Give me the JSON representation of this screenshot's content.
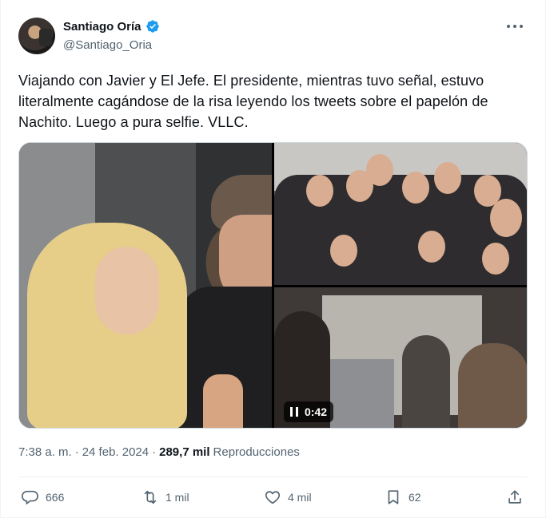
{
  "author": {
    "display_name": "Santiago Oría",
    "handle": "@Santiago_Oria",
    "verified": true
  },
  "tweet": {
    "text": "Viajando con Javier y El Jefe. El presidente, mientras tuvo señal, estuvo literalmente cagándose de la risa leyendo los tweets sobre el papelón de Nachito. Luego a pura selfie. VLLC."
  },
  "media": {
    "video_duration": "0:42"
  },
  "meta": {
    "time": "7:38 a. m.",
    "separator": "·",
    "date": "24 feb. 2024",
    "separator2": "·",
    "views_count": "289,7 mil",
    "views_label": "Reproducciones"
  },
  "actions": {
    "replies": "666",
    "reposts": "1 mil",
    "likes": "4 mil",
    "bookmarks": "62"
  },
  "icons": {
    "verified": "verified-badge-icon",
    "more": "more-icon",
    "reply": "reply-icon",
    "repost": "repost-icon",
    "like": "heart-icon",
    "bookmark": "bookmark-icon",
    "share": "share-icon",
    "pause": "pause-icon"
  },
  "colors": {
    "accent": "#1d9bf0",
    "text": "#0f1419",
    "muted": "#536471"
  }
}
